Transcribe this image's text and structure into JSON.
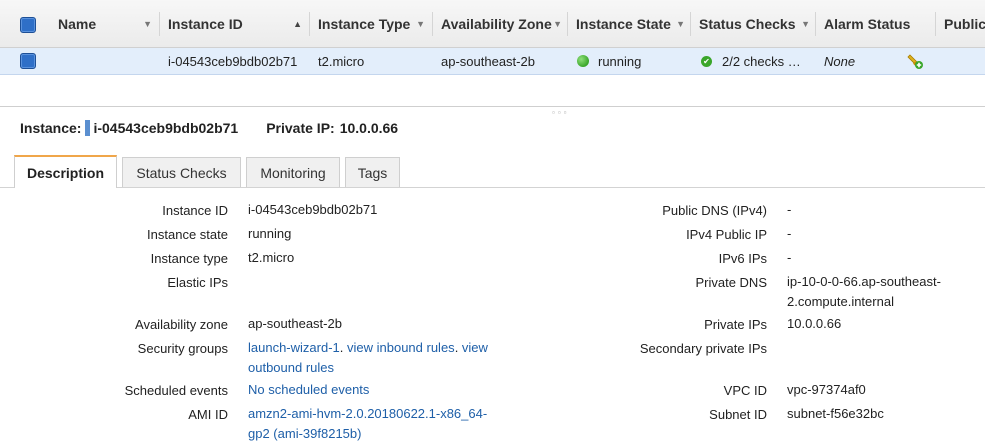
{
  "grid": {
    "columns": [
      "Name",
      "Instance ID",
      "Instance Type",
      "Availability Zone",
      "Instance State",
      "Status Checks",
      "Alarm Status",
      "Public"
    ],
    "row": {
      "instance_id": "i-04543ceb9bdb02b71",
      "instance_type": "t2.micro",
      "availability_zone": "ap-southeast-2b",
      "instance_state": "running",
      "status_checks": "2/2 checks …",
      "alarm_status": "None"
    }
  },
  "header": {
    "instance_label": "Instance:",
    "instance_id": "i-04543ceb9bdb02b71",
    "private_ip_label": "Private IP:",
    "private_ip": "10.0.0.66"
  },
  "tabs": [
    "Description",
    "Status Checks",
    "Monitoring",
    "Tags"
  ],
  "details": {
    "left": {
      "instance_id": {
        "label": "Instance ID",
        "value": "i-04543ceb9bdb02b71"
      },
      "instance_state": {
        "label": "Instance state",
        "value": "running"
      },
      "instance_type": {
        "label": "Instance type",
        "value": "t2.micro"
      },
      "elastic_ips": {
        "label": "Elastic IPs",
        "value": ""
      },
      "availability_zone": {
        "label": "Availability zone",
        "value": "ap-southeast-2b"
      },
      "security_groups": {
        "label": "Security groups",
        "link1": "launch-wizard-1",
        "sep": ". ",
        "link2": "view inbound rules",
        "sep2": ". ",
        "link3a": "view",
        "link3b": "outbound rules"
      },
      "scheduled_events": {
        "label": "Scheduled events",
        "value": "No scheduled events"
      },
      "ami_id": {
        "label": "AMI ID",
        "value_line1": "amzn2-ami-hvm-2.0.20180622.1-x86_64-",
        "value_line2": "gp2 (ami-39f8215b)"
      }
    },
    "right": {
      "public_dns": {
        "label": "Public DNS (IPv4)",
        "value": "-"
      },
      "ipv4_public_ip": {
        "label": "IPv4 Public IP",
        "value": "-"
      },
      "ipv6_ips": {
        "label": "IPv6 IPs",
        "value": "-"
      },
      "private_dns": {
        "label": "Private DNS",
        "value_line1": "ip-10-0-0-66.ap-southeast-",
        "value_line2": "2.compute.internal"
      },
      "private_ips": {
        "label": "Private IPs",
        "value": "10.0.0.66"
      },
      "secondary_private_ips": {
        "label": "Secondary private IPs",
        "value": ""
      },
      "vpc_id": {
        "label": "VPC ID",
        "value": "vpc-97374af0"
      },
      "subnet_id": {
        "label": "Subnet ID",
        "value": "subnet-f56e32bc"
      }
    }
  },
  "colors": {
    "selection_bg": "#e3eefb",
    "link": "#1e5fa8",
    "running_green": "#3aa62a",
    "active_tab_accent": "#f0a64a"
  }
}
